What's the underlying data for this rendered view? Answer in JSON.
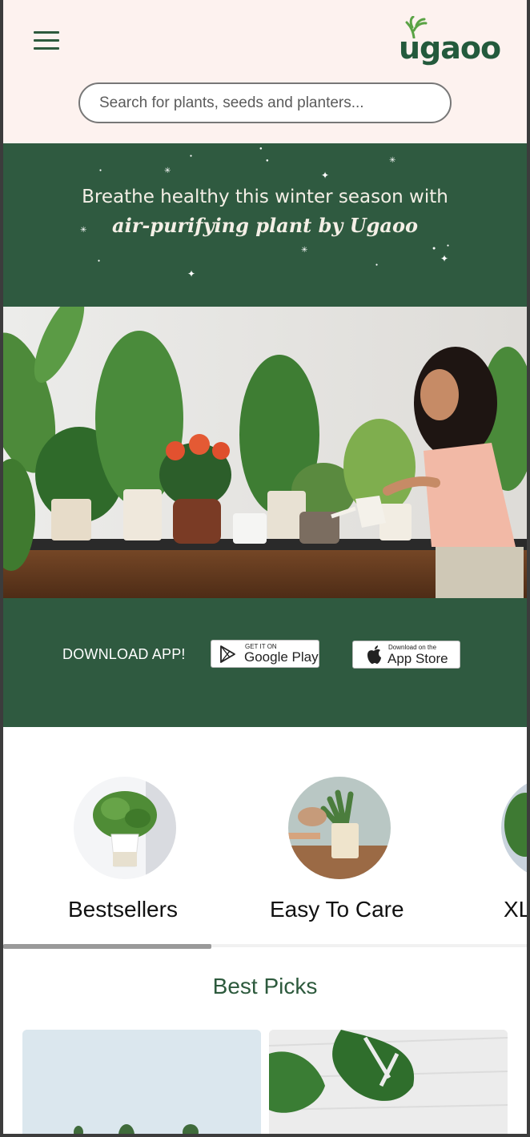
{
  "header": {
    "logo_text": "ugaoo",
    "search_placeholder": "Search for plants, seeds and planters..."
  },
  "banner": {
    "line1": "Breathe healthy this winter season with",
    "line2": "air-purifying plant by Ugaoo",
    "download_label": "DOWNLOAD APP!",
    "google_play": {
      "small": "GET IT ON",
      "big": "Google Play"
    },
    "app_store": {
      "small": "Download on the",
      "big": "App Store"
    }
  },
  "categories": [
    {
      "label": "Bestsellers"
    },
    {
      "label": "Easy To Care"
    },
    {
      "label": "XL"
    }
  ],
  "section_title": "Best Picks",
  "colors": {
    "header_bg": "#fdf2ef",
    "brand_green": "#2f5a40",
    "text_green": "#2d5a3d"
  },
  "icons": [
    "hamburger-menu-icon",
    "ugaoo-logo",
    "google-play-icon",
    "apple-icon",
    "sparkle-icon"
  ]
}
